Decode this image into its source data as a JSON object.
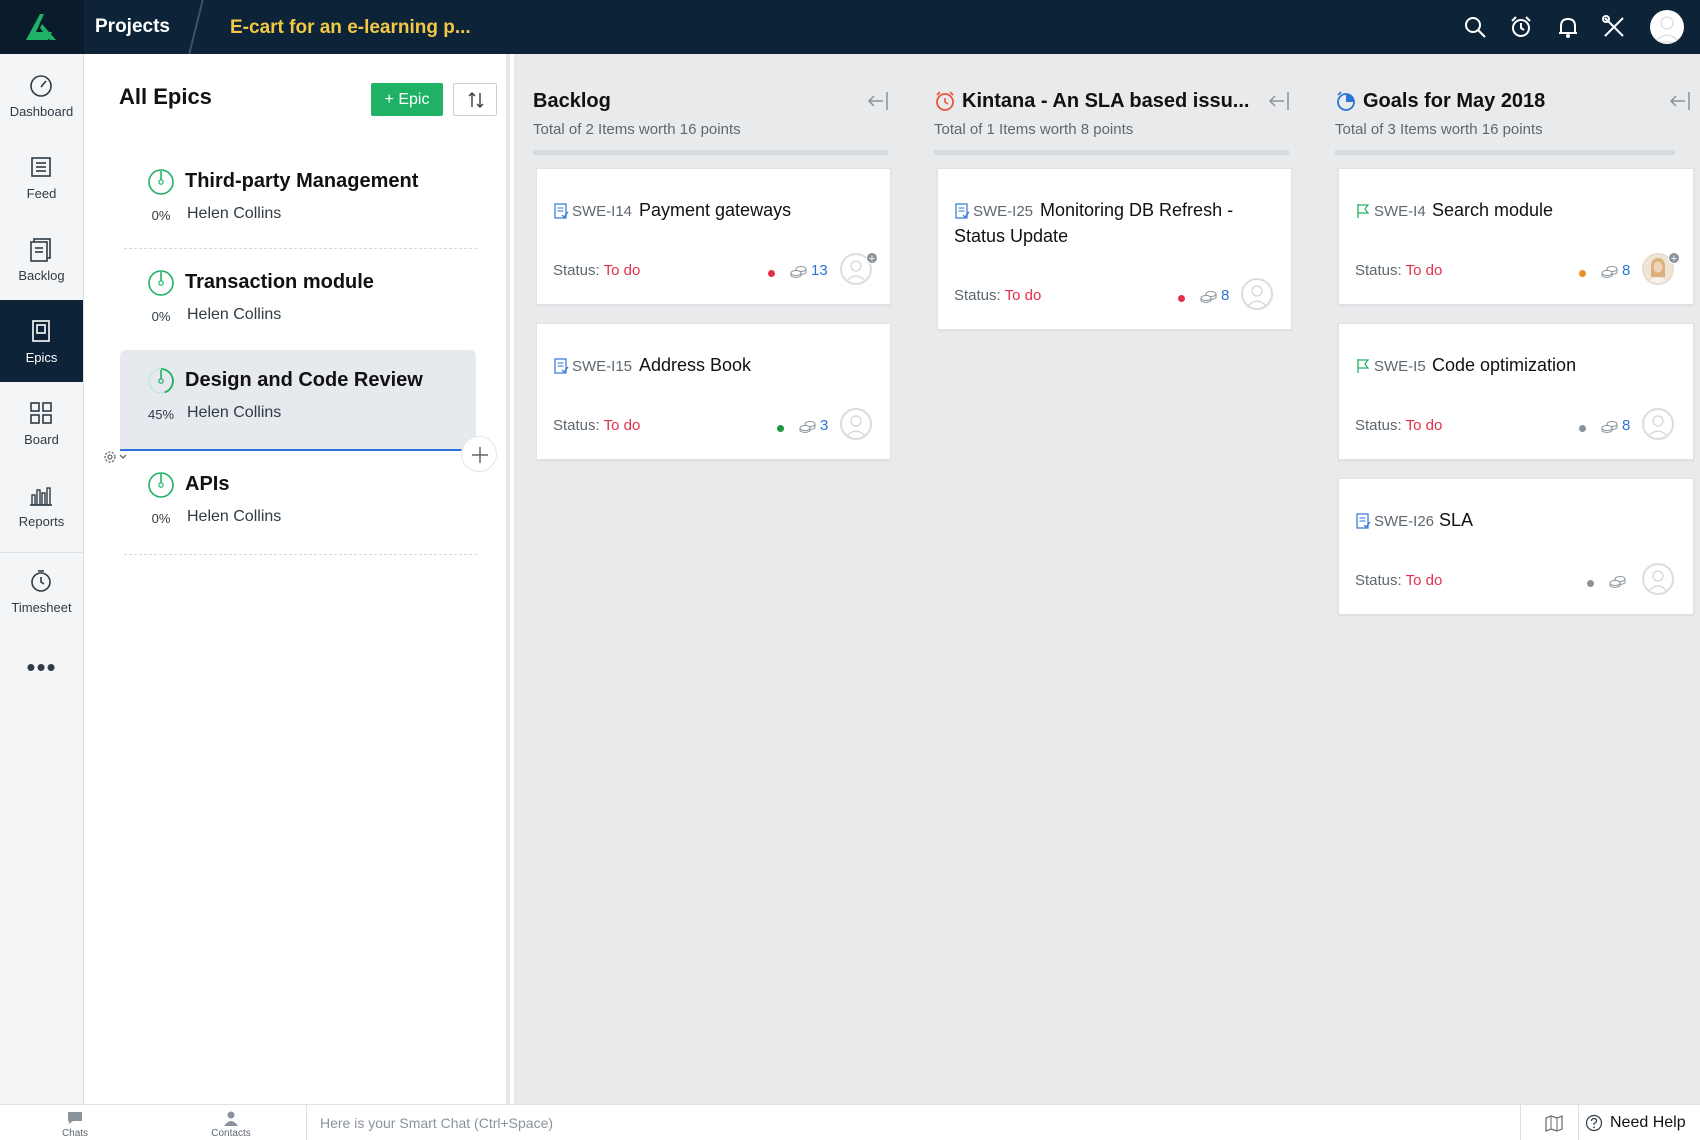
{
  "topbar": {
    "section_title": "Projects",
    "project_name": "E-cart for an e-learning p..."
  },
  "leftnav": {
    "items": [
      {
        "label": "Dashboard",
        "icon": "dashboard-icon"
      },
      {
        "label": "Feed",
        "icon": "feed-icon"
      },
      {
        "label": "Backlog",
        "icon": "backlog-icon"
      },
      {
        "label": "Epics",
        "icon": "epics-icon",
        "active": true
      },
      {
        "label": "Board",
        "icon": "board-icon"
      },
      {
        "label": "Reports",
        "icon": "reports-icon"
      },
      {
        "label": "Timesheet",
        "icon": "timesheet-icon"
      }
    ],
    "more": "•••"
  },
  "epics": {
    "title": "All Epics",
    "add_label": "+ Epic",
    "items": [
      {
        "name": "Third-party Management",
        "progress": "0%",
        "owner": "Helen Collins"
      },
      {
        "name": "Transaction module",
        "progress": "0%",
        "owner": "Helen Collins"
      },
      {
        "name": "Design and Code Review",
        "progress": "45%",
        "owner": "Helen Collins",
        "selected": true
      },
      {
        "name": "APIs",
        "progress": "0%",
        "owner": "Helen Collins"
      }
    ]
  },
  "board": {
    "columns": [
      {
        "title": "Backlog",
        "subtitle": "Total of 2 Items worth 16 points",
        "cards": [
          {
            "key": "SWE-I14",
            "title": "Payment gateways",
            "status_label": "Status:",
            "status": "To do",
            "priority_color": "#e3304a",
            "points": "13"
          },
          {
            "key": "SWE-I15",
            "title": "Address Book",
            "status_label": "Status:",
            "status": "To do",
            "priority_color": "#1a9a3c",
            "points": "3"
          }
        ]
      },
      {
        "title": "Kintana - An SLA based issu...",
        "subtitle": "Total of 1 Items worth 8 points",
        "cards": [
          {
            "key": "SWE-I25",
            "title": "Monitoring DB Refresh -",
            "title_line2": "Status Update",
            "status_label": "Status:",
            "status": "To do",
            "priority_color": "#e3304a",
            "points": "8"
          }
        ]
      },
      {
        "title": "Goals for May 2018",
        "subtitle": "Total of 3 Items worth 16 points",
        "cards": [
          {
            "key": "SWE-I4",
            "title": "Search module",
            "status_label": "Status:",
            "status": "To do",
            "priority_color": "#f08c2a",
            "points": "8"
          },
          {
            "key": "SWE-I5",
            "title": "Code optimization",
            "status_label": "Status:",
            "status": "To do",
            "priority_color": "#8a939b",
            "points": "8"
          },
          {
            "key": "SWE-I26",
            "title": "SLA",
            "status_label": "Status:",
            "status": "To do",
            "priority_color": "#8a939b",
            "points": ""
          }
        ]
      }
    ]
  },
  "bottombar": {
    "chats_label": "Chats",
    "contacts_label": "Contacts",
    "smartchat_placeholder": "Here is your Smart Chat (Ctrl+Space)",
    "need_help": "Need Help"
  },
  "colors": {
    "topbar": "#0d2438",
    "accent_green": "#1fb264",
    "project_name": "#f2c744",
    "status_todo": "#e3304a",
    "points_blue": "#2d74d6"
  }
}
